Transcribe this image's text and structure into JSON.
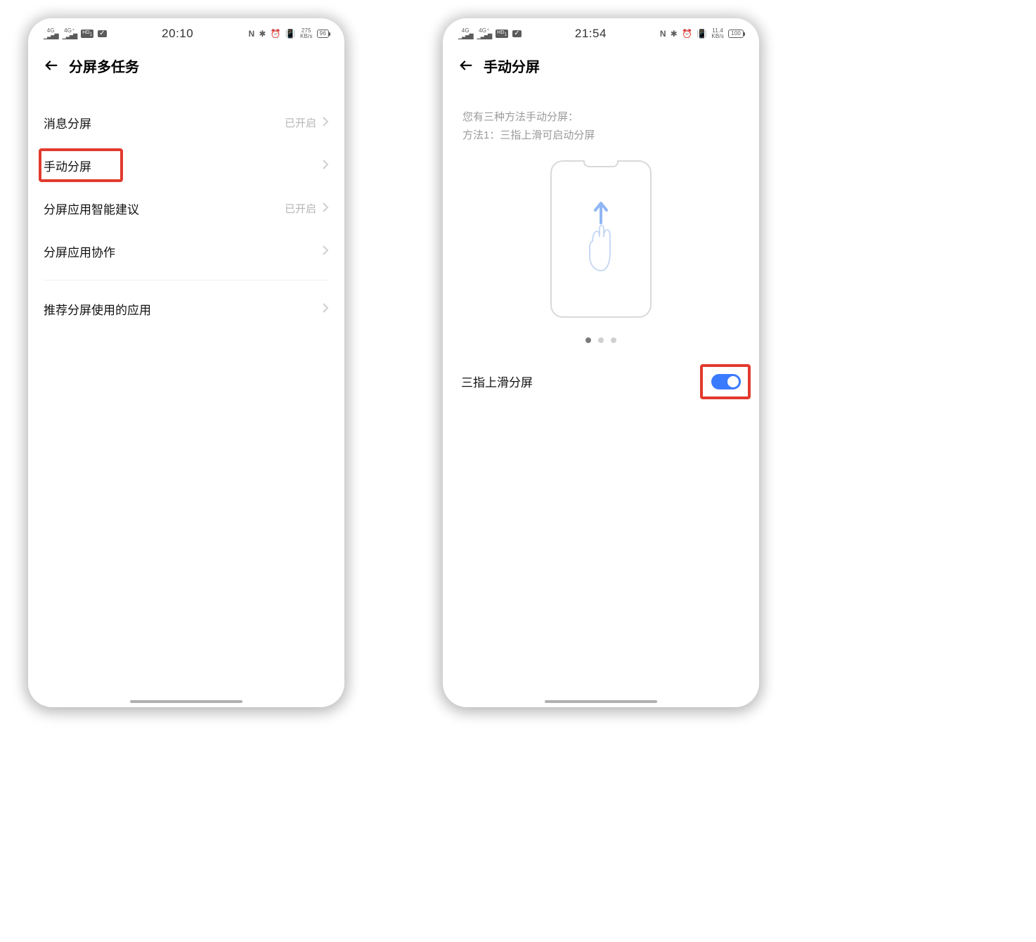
{
  "left": {
    "status": {
      "sig1_top": "4G",
      "sig2_top": "4G⁺",
      "hd": "HD",
      "time": "20:10",
      "nfc": "N",
      "bt": "✱",
      "alarm": "⏰",
      "vib": "📳",
      "net_top": "275",
      "net_bot": "KB/s",
      "battery": "96"
    },
    "title": "分屏多任务",
    "rows": [
      {
        "label": "消息分屏",
        "status": "已开启",
        "highlight": false
      },
      {
        "label": "手动分屏",
        "status": "",
        "highlight": true
      },
      {
        "label": "分屏应用智能建议",
        "status": "已开启",
        "highlight": false
      },
      {
        "label": "分屏应用协作",
        "status": "",
        "highlight": false
      },
      {
        "label": "推荐分屏使用的应用",
        "status": "",
        "highlight": false
      }
    ]
  },
  "right": {
    "status": {
      "sig1_top": "4G",
      "sig2_top": "4G⁺",
      "hd": "HD",
      "time": "21:54",
      "nfc": "N",
      "bt": "✱",
      "alarm": "⏰",
      "vib": "📳",
      "net_top": "11.4",
      "net_bot": "KB/s",
      "battery": "100"
    },
    "title": "手动分屏",
    "hint_line1": "您有三种方法手动分屏：",
    "hint_line2": "方法1：三指上滑可启动分屏",
    "toggle_label": "三指上滑分屏",
    "toggle_on": true
  }
}
